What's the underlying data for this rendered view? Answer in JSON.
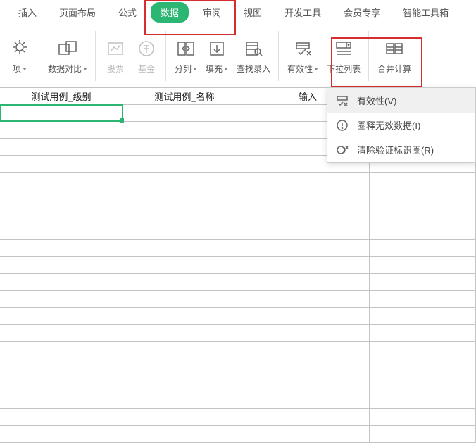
{
  "ribbon": {
    "tabs": [
      "插入",
      "页面布局",
      "公式",
      "数据",
      "审阅",
      "视图",
      "开发工具",
      "会员专享",
      "智能工具箱"
    ],
    "active_tab_index": 3,
    "groups": {
      "opts": "项",
      "compare": "数据对比",
      "stock": "股票",
      "fund": "基金",
      "split": "分列",
      "fill": "填充",
      "lookup": "查找录入",
      "validity": "有效性",
      "dropdown_list": "下拉列表",
      "merge_calc": "合并计算"
    }
  },
  "dropdown": {
    "items": [
      "有效性(V)",
      "圈释无效数据(I)",
      "清除验证标识圈(R)"
    ]
  },
  "sheet": {
    "headers": [
      "测试用例_级别",
      "测试用例_名称",
      "输入",
      ""
    ],
    "num_blank_rows": 20
  }
}
